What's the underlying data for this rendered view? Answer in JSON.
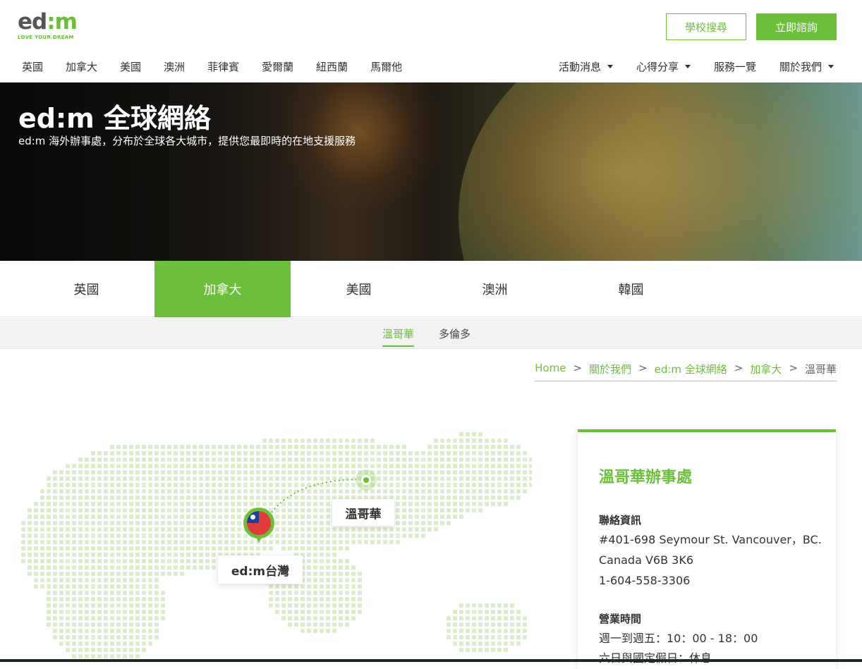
{
  "header": {
    "logo_text": "ed:m",
    "logo_tagline": "LOVE YOUR DREAM",
    "school_search_button": "學校搜尋",
    "consult_button": "立即諮詢",
    "nav_left": [
      "英國",
      "加拿大",
      "美國",
      "澳洲",
      "菲律賓",
      "愛爾蘭",
      "紐西蘭",
      "馬爾他"
    ],
    "nav_right": [
      {
        "label": "活動消息",
        "dropdown": true
      },
      {
        "label": "心得分享",
        "dropdown": true
      },
      {
        "label": "服務一覽",
        "dropdown": false
      },
      {
        "label": "關於我們",
        "dropdown": true
      }
    ]
  },
  "hero": {
    "title": "ed:m 全球網絡",
    "subtitle": "ed:m 海外辦事處，分布於全球各大城市，提供您最即時的在地支援服務"
  },
  "country_tabs": {
    "items": [
      "英國",
      "加拿大",
      "美國",
      "澳洲",
      "韓國"
    ],
    "active": "加拿大"
  },
  "city_tabs": {
    "items": [
      "溫哥華",
      "多倫多"
    ],
    "active": "溫哥華"
  },
  "breadcrumb": {
    "items": [
      "Home",
      "關於我們",
      "ed:m 全球網絡",
      "加拿大"
    ],
    "current": "溫哥華",
    "separator": ">"
  },
  "map": {
    "origin_label": "ed:m台灣",
    "destination_label": "溫哥華"
  },
  "office": {
    "title": "溫哥華辦事處",
    "contact_heading": "聯絡資訊",
    "address_line1": "#401-698 Seymour St. Vancouver，BC.",
    "address_line2": "Canada V6B 3K6",
    "phone": "1-604-558-3306",
    "hours_heading": "營業時間",
    "hours_weekday": "週一到週五：10：00 - 18：00",
    "hours_weekend": "六日與國定假日：休息"
  },
  "colors": {
    "accent": "#6cbf3b",
    "text": "#333333",
    "map_dots": "#dcedcc"
  }
}
